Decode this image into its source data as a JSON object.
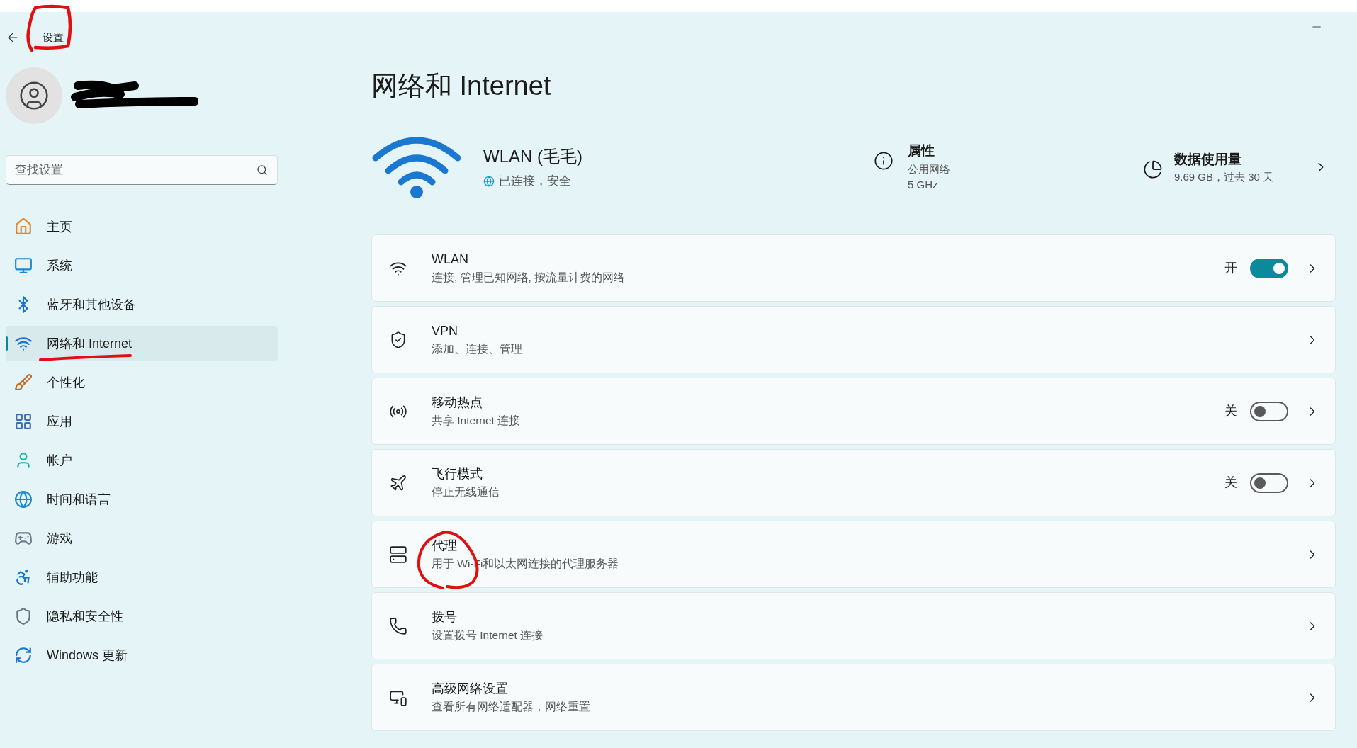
{
  "window": {
    "title": "设置"
  },
  "user": {
    "kind": "redacted"
  },
  "search": {
    "placeholder": "查找设置"
  },
  "sidebar": {
    "items": [
      {
        "label": "主页",
        "selected": false
      },
      {
        "label": "系统",
        "selected": false
      },
      {
        "label": "蓝牙和其他设备",
        "selected": false
      },
      {
        "label": "网络和 Internet",
        "selected": true
      },
      {
        "label": "个性化",
        "selected": false
      },
      {
        "label": "应用",
        "selected": false
      },
      {
        "label": "帐户",
        "selected": false
      },
      {
        "label": "时间和语言",
        "selected": false
      },
      {
        "label": "游戏",
        "selected": false
      },
      {
        "label": "辅助功能",
        "selected": false
      },
      {
        "label": "隐私和安全性",
        "selected": false
      },
      {
        "label": "Windows 更新",
        "selected": false
      }
    ]
  },
  "page": {
    "title": "网络和 Internet"
  },
  "connection": {
    "name": "WLAN (毛毛)",
    "status": "已连接，安全",
    "properties": {
      "title": "属性",
      "lines": [
        "公用网络",
        "5 GHz"
      ]
    },
    "data_usage": {
      "title": "数据使用量",
      "detail": "9.69 GB，过去 30 天"
    }
  },
  "settings": [
    {
      "kind": "toggle",
      "title": "WLAN",
      "subtitle": "连接, 管理已知网络, 按流量计费的网络",
      "state_label": "开",
      "on": true
    },
    {
      "kind": "link",
      "title": "VPN",
      "subtitle": "添加、连接、管理"
    },
    {
      "kind": "toggle",
      "title": "移动热点",
      "subtitle": "共享 Internet 连接",
      "state_label": "关",
      "on": false
    },
    {
      "kind": "toggle",
      "title": "飞行模式",
      "subtitle": "停止无线通信",
      "state_label": "关",
      "on": false
    },
    {
      "kind": "link",
      "title": "代理",
      "subtitle": "用于 Wi-Fi和以太网连接的代理服务器"
    },
    {
      "kind": "link",
      "title": "拨号",
      "subtitle": "设置拨号 Internet 连接"
    },
    {
      "kind": "link",
      "title": "高级网络设置",
      "subtitle": "查看所有网络适配器，网络重置"
    }
  ]
}
